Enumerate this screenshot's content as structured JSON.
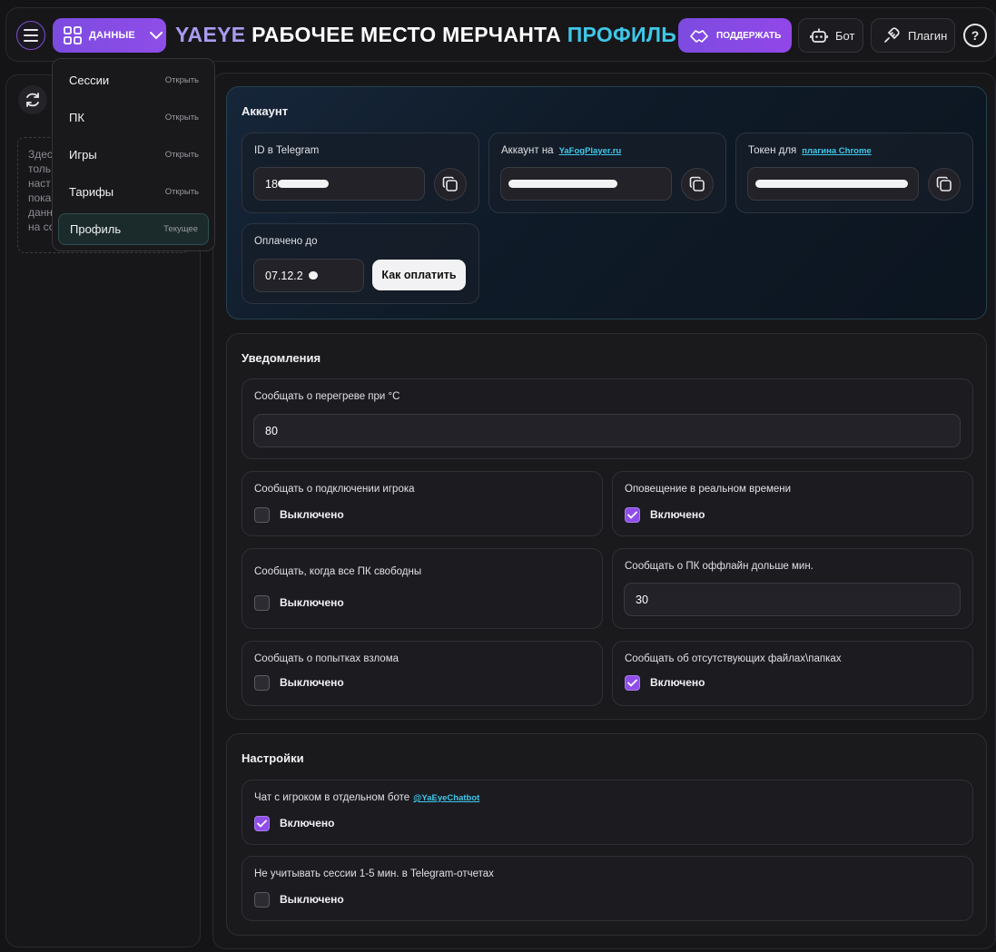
{
  "header": {
    "data_label": "Данные",
    "title_brand": "YAEYE",
    "title_main": "РАБОЧЕЕ МЕСТО МЕРЧАНТА",
    "title_section": "ПРОФИЛЬ",
    "support_label": "Поддержать",
    "bot_label": "Бот",
    "plugin_label": "Плагин",
    "help_label": "?"
  },
  "dropdown": {
    "items": [
      {
        "label": "Сессии",
        "status": "Открыть"
      },
      {
        "label": "ПК",
        "status": "Открыть"
      },
      {
        "label": "Игры",
        "status": "Открыть"
      },
      {
        "label": "Тарифы",
        "status": "Открыть"
      },
      {
        "label": "Профиль",
        "status": "Текущее"
      }
    ]
  },
  "left_panel": {
    "note_lines": [
      "Здес",
      "толь",
      "наст",
      "пока",
      "данн",
      "на со"
    ]
  },
  "account": {
    "heading": "Аккаунт",
    "telegram_label": "ID в Telegram",
    "telegram_value": "18",
    "site_label": "Аккаунт на",
    "site_link": "YaFogPlayer.ru",
    "token_label": "Токен для",
    "token_link": "плагина Chrome",
    "paid_label": "Оплачено до",
    "paid_value": "07.12.2",
    "pay_button": "Как оплатить"
  },
  "notifications": {
    "heading": "Уведомления",
    "overheat_label": "Сообщать о перегреве при °C",
    "overheat_value": "80",
    "player_connect_label": "Сообщать о подключении игрока",
    "player_connect_state": "Выключено",
    "realtime_label": "Оповещение в реальном времени",
    "realtime_state": "Включено",
    "all_free_label": "Сообщать, когда все ПК свободны",
    "all_free_state": "Выключено",
    "offline_label": "Сообщать о ПК оффлайн дольше мин.",
    "offline_value": "30",
    "hack_label": "Сообщать о попытках взлома",
    "hack_state": "Выключено",
    "missing_files_label": "Сообщать об отсутствующих файлах\\папках",
    "missing_files_state": "Включено"
  },
  "settings": {
    "heading": "Настройки",
    "chat_label": "Чат с игроком в отдельном боте",
    "chat_link": "@YaEyeChatbot",
    "chat_state": "Включено",
    "short_sessions_label": "Не учитывать сессии 1-5 мин. в Telegram-отчетах",
    "short_sessions_state": "Выключено"
  },
  "colors": {
    "accent_purple": "#8f4de8",
    "accent_cyan": "#3fc7e8",
    "background": "#141416"
  },
  "icons": {
    "menu": "hamburger-icon",
    "data": "grid-icon",
    "chevron": "chevron-down-icon",
    "support": "handshake-icon",
    "bot": "robot-icon",
    "plugin": "plug-icon",
    "help": "help-icon",
    "refresh": "refresh-icon",
    "copy": "copy-icon",
    "check": "check-icon"
  }
}
